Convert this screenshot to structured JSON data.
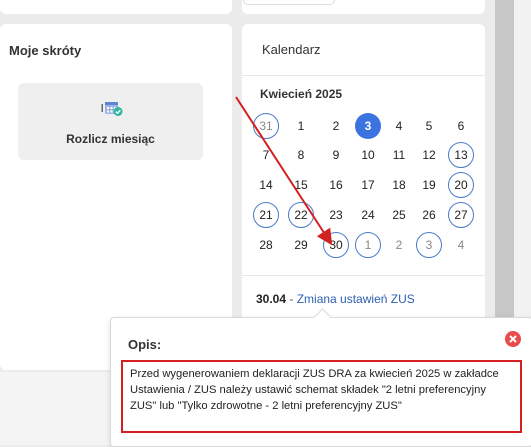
{
  "shortcuts": {
    "title": "Moje skróty",
    "items": [
      {
        "label": "Rozlicz miesiąc",
        "icon": "calendar-check-icon"
      }
    ]
  },
  "calendar": {
    "title": "Kalendarz",
    "month": "Kwiecień 2025",
    "weeks": [
      [
        "31",
        "1",
        "2",
        "3",
        "4",
        "5",
        "6"
      ],
      [
        "7",
        "8",
        "9",
        "10",
        "11",
        "12",
        "13"
      ],
      [
        "14",
        "15",
        "16",
        "17",
        "18",
        "19",
        "20"
      ],
      [
        "21",
        "22",
        "23",
        "24",
        "25",
        "26",
        "27"
      ],
      [
        "28",
        "29",
        "30",
        "1",
        "2",
        "3",
        "4"
      ]
    ],
    "today": "3",
    "event": {
      "date": "30.04",
      "separator": " - ",
      "title": "Zmiana ustawień ZUS"
    }
  },
  "popup": {
    "title": "Opis:",
    "description": "Przed wygenerowaniem deklaracji ZUS DRA za kwiecień 2025 w zakładce Ustawienia / ZUS należy ustawić schemat składek \"2 letni preferencyjny ZUS\" lub \"Tylko zdrowotne - 2 letni preferencyjny ZUS\""
  },
  "colors": {
    "today": "#3b73e0",
    "outline": "#4a7cc7",
    "annotation": "#d32020",
    "close": "#e84b4b",
    "link": "#2b5fb3"
  }
}
